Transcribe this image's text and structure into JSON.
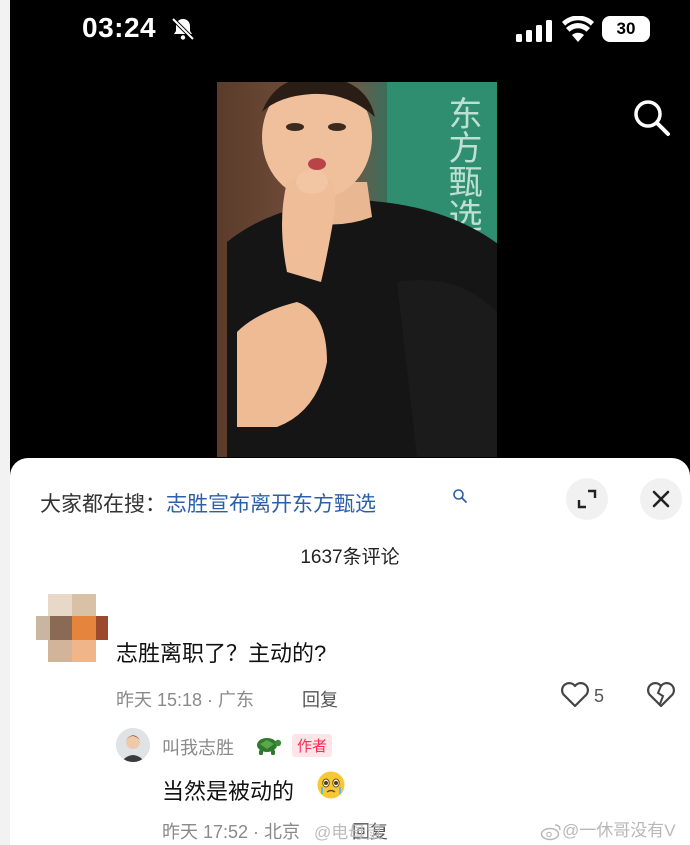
{
  "status_bar": {
    "time": "03:24",
    "battery": "30"
  },
  "video": {
    "sign_text": "东方甄选"
  },
  "sheet": {
    "search_prefix": "大家都在搜：",
    "search_keyword": "志胜宣布离开东方甄选",
    "comment_count": "1637条评论"
  },
  "comment": {
    "text": "志胜离职了？主动的?",
    "meta": "昨天 15:18 · 广东",
    "reply_label": "回复",
    "likes": "5"
  },
  "reply": {
    "author": "叫我志胜",
    "badge": "作者",
    "text": "当然是被动的",
    "meta": "昨天 17:52 · 北京",
    "reply_label": "回复"
  },
  "watermarks": {
    "mid": "@电母鼠",
    "corner": "@一休哥没有V"
  },
  "icons": [
    "bell-muted-icon",
    "signal-icon",
    "wifi-icon",
    "battery-icon",
    "search-icon",
    "expand-icon",
    "close-icon",
    "magnifier-icon",
    "heart-icon",
    "broken-heart-icon",
    "turtle-icon",
    "crying-emoji-icon",
    "weibo-icon"
  ]
}
